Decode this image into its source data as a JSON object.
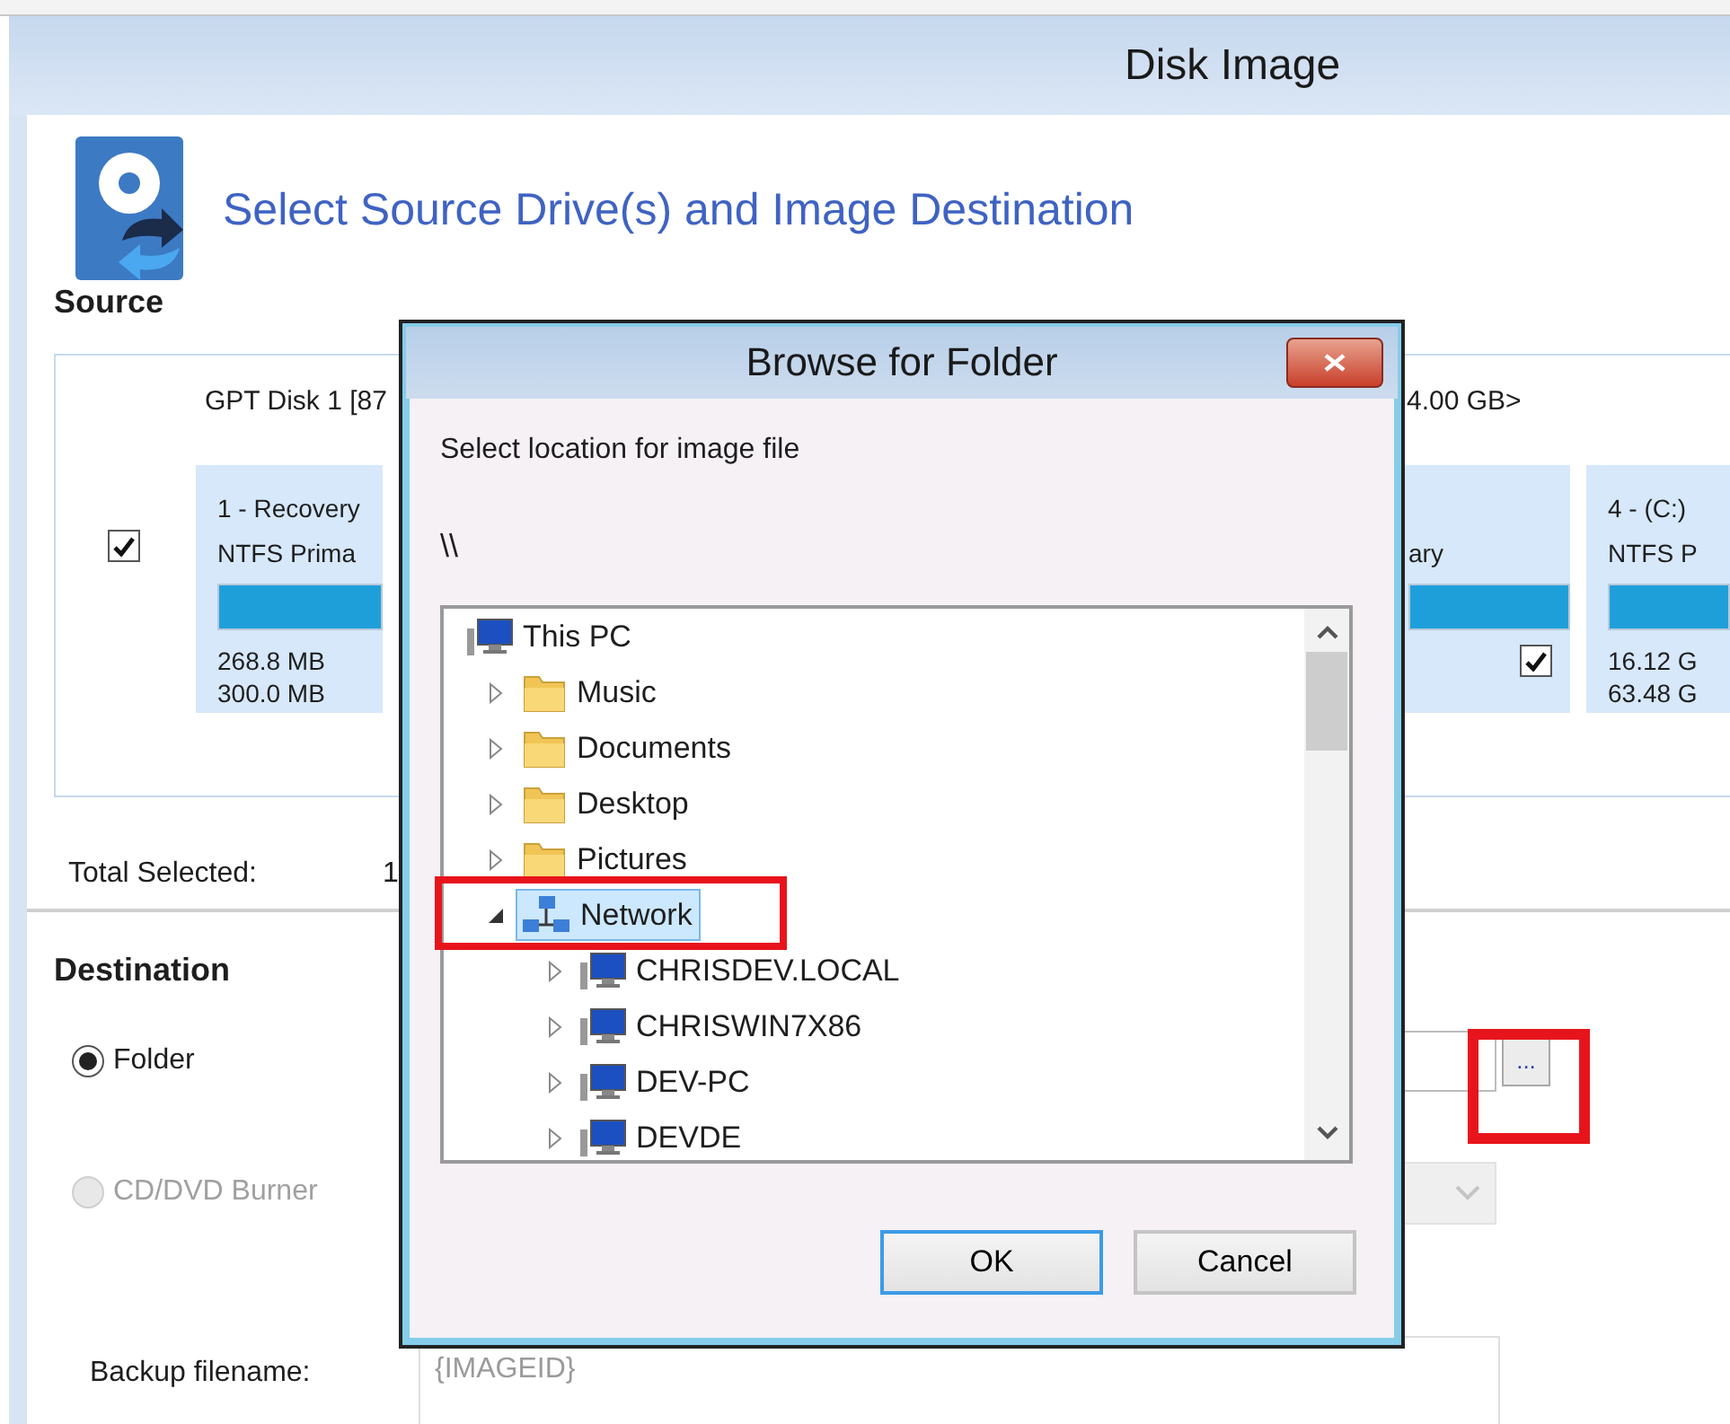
{
  "window": {
    "title": "Disk Image",
    "heading": "Select Source Drive(s) and Image Destination"
  },
  "source": {
    "label": "Source",
    "disk": {
      "label": "GPT Disk 1 [87",
      "size": "4.00 GB>",
      "checked": true
    },
    "partitions": [
      {
        "title": "1 - Recovery",
        "type": "NTFS Prima",
        "used": "268.8 MB",
        "total": "300.0 MB"
      },
      {
        "type": "ary",
        "checked": true
      },
      {
        "title": "4 - (C:)",
        "type": "NTFS P",
        "used": "16.12 G",
        "total": "63.48 G"
      }
    ]
  },
  "total_selected": {
    "label": "Total Selected:",
    "value": "1"
  },
  "destination": {
    "label": "Destination",
    "options": [
      {
        "label": "Folder",
        "selected": true,
        "disabled": false
      },
      {
        "label": "CD/DVD Burner",
        "selected": false,
        "disabled": true
      }
    ],
    "browse_button": "...",
    "filename": {
      "label": "Backup filename:",
      "placeholder": "{IMAGEID}"
    }
  },
  "dialog": {
    "title": "Browse for Folder",
    "prompt": "Select location for image file",
    "path": "\\\\",
    "tree": [
      {
        "label": "This PC",
        "kind": "computer",
        "selected": false,
        "children": [
          {
            "label": "Music",
            "kind": "folder",
            "expanded": false,
            "selected": false
          },
          {
            "label": "Documents",
            "kind": "folder",
            "expanded": false,
            "selected": false
          },
          {
            "label": "Desktop",
            "kind": "folder",
            "expanded": false,
            "selected": false
          },
          {
            "label": "Pictures",
            "kind": "folder",
            "expanded": false,
            "selected": false
          },
          {
            "label": "Network",
            "kind": "network",
            "expanded": true,
            "selected": true,
            "children": [
              {
                "label": "CHRISDEV.LOCAL",
                "kind": "computer",
                "expanded": false,
                "selected": false
              },
              {
                "label": "CHRISWIN7X86",
                "kind": "computer",
                "expanded": false,
                "selected": false
              },
              {
                "label": "DEV-PC",
                "kind": "computer",
                "expanded": false,
                "selected": false
              },
              {
                "label": "DEVDE",
                "kind": "computer",
                "expanded": false,
                "selected": false
              }
            ]
          }
        ]
      }
    ],
    "buttons": [
      {
        "label": "OK",
        "default": true
      },
      {
        "label": "Cancel",
        "default": false
      }
    ]
  }
}
